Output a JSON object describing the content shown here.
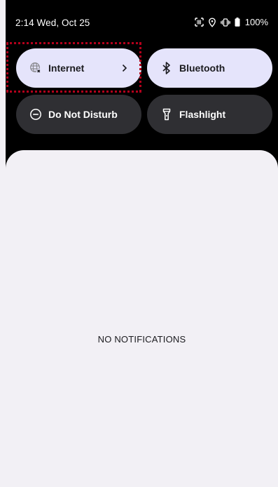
{
  "status_bar": {
    "time": "2:14 Wed, Oct 25",
    "battery": "100%",
    "icons": [
      "barcode-scanner-icon",
      "location-icon",
      "vibrate-icon",
      "battery-icon"
    ]
  },
  "tiles": [
    {
      "label": "Internet",
      "icon": "internet-off-icon",
      "state": "active",
      "has_chevron": true
    },
    {
      "label": "Bluetooth",
      "icon": "bluetooth-icon",
      "state": "active",
      "has_chevron": false
    },
    {
      "label": "Do Not Disturb",
      "icon": "do-not-disturb-icon",
      "state": "inactive",
      "has_chevron": false
    },
    {
      "label": "Flashlight",
      "icon": "flashlight-icon",
      "state": "inactive",
      "has_chevron": false
    }
  ],
  "notifications": {
    "empty_text": "NO NOTIFICATIONS"
  },
  "colors": {
    "active_tile": "#e5e4fb",
    "inactive_tile": "#2f2f33",
    "shade_background": "#f2f0f5",
    "highlight": "#b3001b"
  }
}
